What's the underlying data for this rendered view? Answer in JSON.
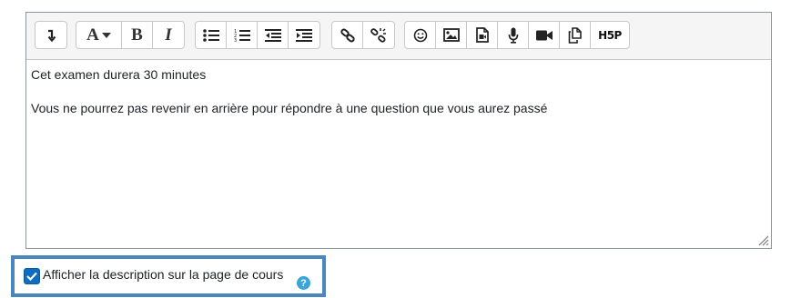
{
  "toolbar": {
    "groups": [
      [
        {
          "name": "toolbar-toggle",
          "icon": "collapse-arrow-icon"
        }
      ],
      [
        {
          "name": "font-color",
          "icon": "font-color-icon",
          "label": "A"
        },
        {
          "name": "bold",
          "icon": "bold-icon",
          "label": "B"
        },
        {
          "name": "italic",
          "icon": "italic-icon",
          "label": "I"
        }
      ],
      [
        {
          "name": "unordered-list",
          "icon": "bullet-list-icon"
        },
        {
          "name": "ordered-list",
          "icon": "numbered-list-icon"
        },
        {
          "name": "outdent",
          "icon": "outdent-icon"
        },
        {
          "name": "indent",
          "icon": "indent-icon"
        }
      ],
      [
        {
          "name": "link",
          "icon": "link-icon"
        },
        {
          "name": "unlink",
          "icon": "unlink-icon"
        }
      ],
      [
        {
          "name": "emoji",
          "icon": "emoji-icon"
        },
        {
          "name": "image",
          "icon": "image-icon"
        },
        {
          "name": "media",
          "icon": "media-icon"
        },
        {
          "name": "record-audio",
          "icon": "microphone-icon"
        },
        {
          "name": "record-video",
          "icon": "video-camera-icon"
        },
        {
          "name": "manage-files",
          "icon": "copy-files-icon"
        },
        {
          "name": "h5p",
          "icon": "h5p-icon",
          "label": "H5P"
        }
      ]
    ]
  },
  "editor": {
    "paragraphs": [
      "Cet examen durera 30 minutes",
      "Vous ne pourrez pas revenir en arrière pour répondre à une question que vous aurez passé"
    ]
  },
  "show_description": {
    "label": "Afficher la description sur la page de cours",
    "checked": true,
    "help_icon": "question-circle-icon",
    "help_glyph": "?"
  },
  "colors": {
    "checkbox": "#0f6cbf",
    "highlight_border": "#4a86c0",
    "help_icon": "#3aa5d6"
  }
}
